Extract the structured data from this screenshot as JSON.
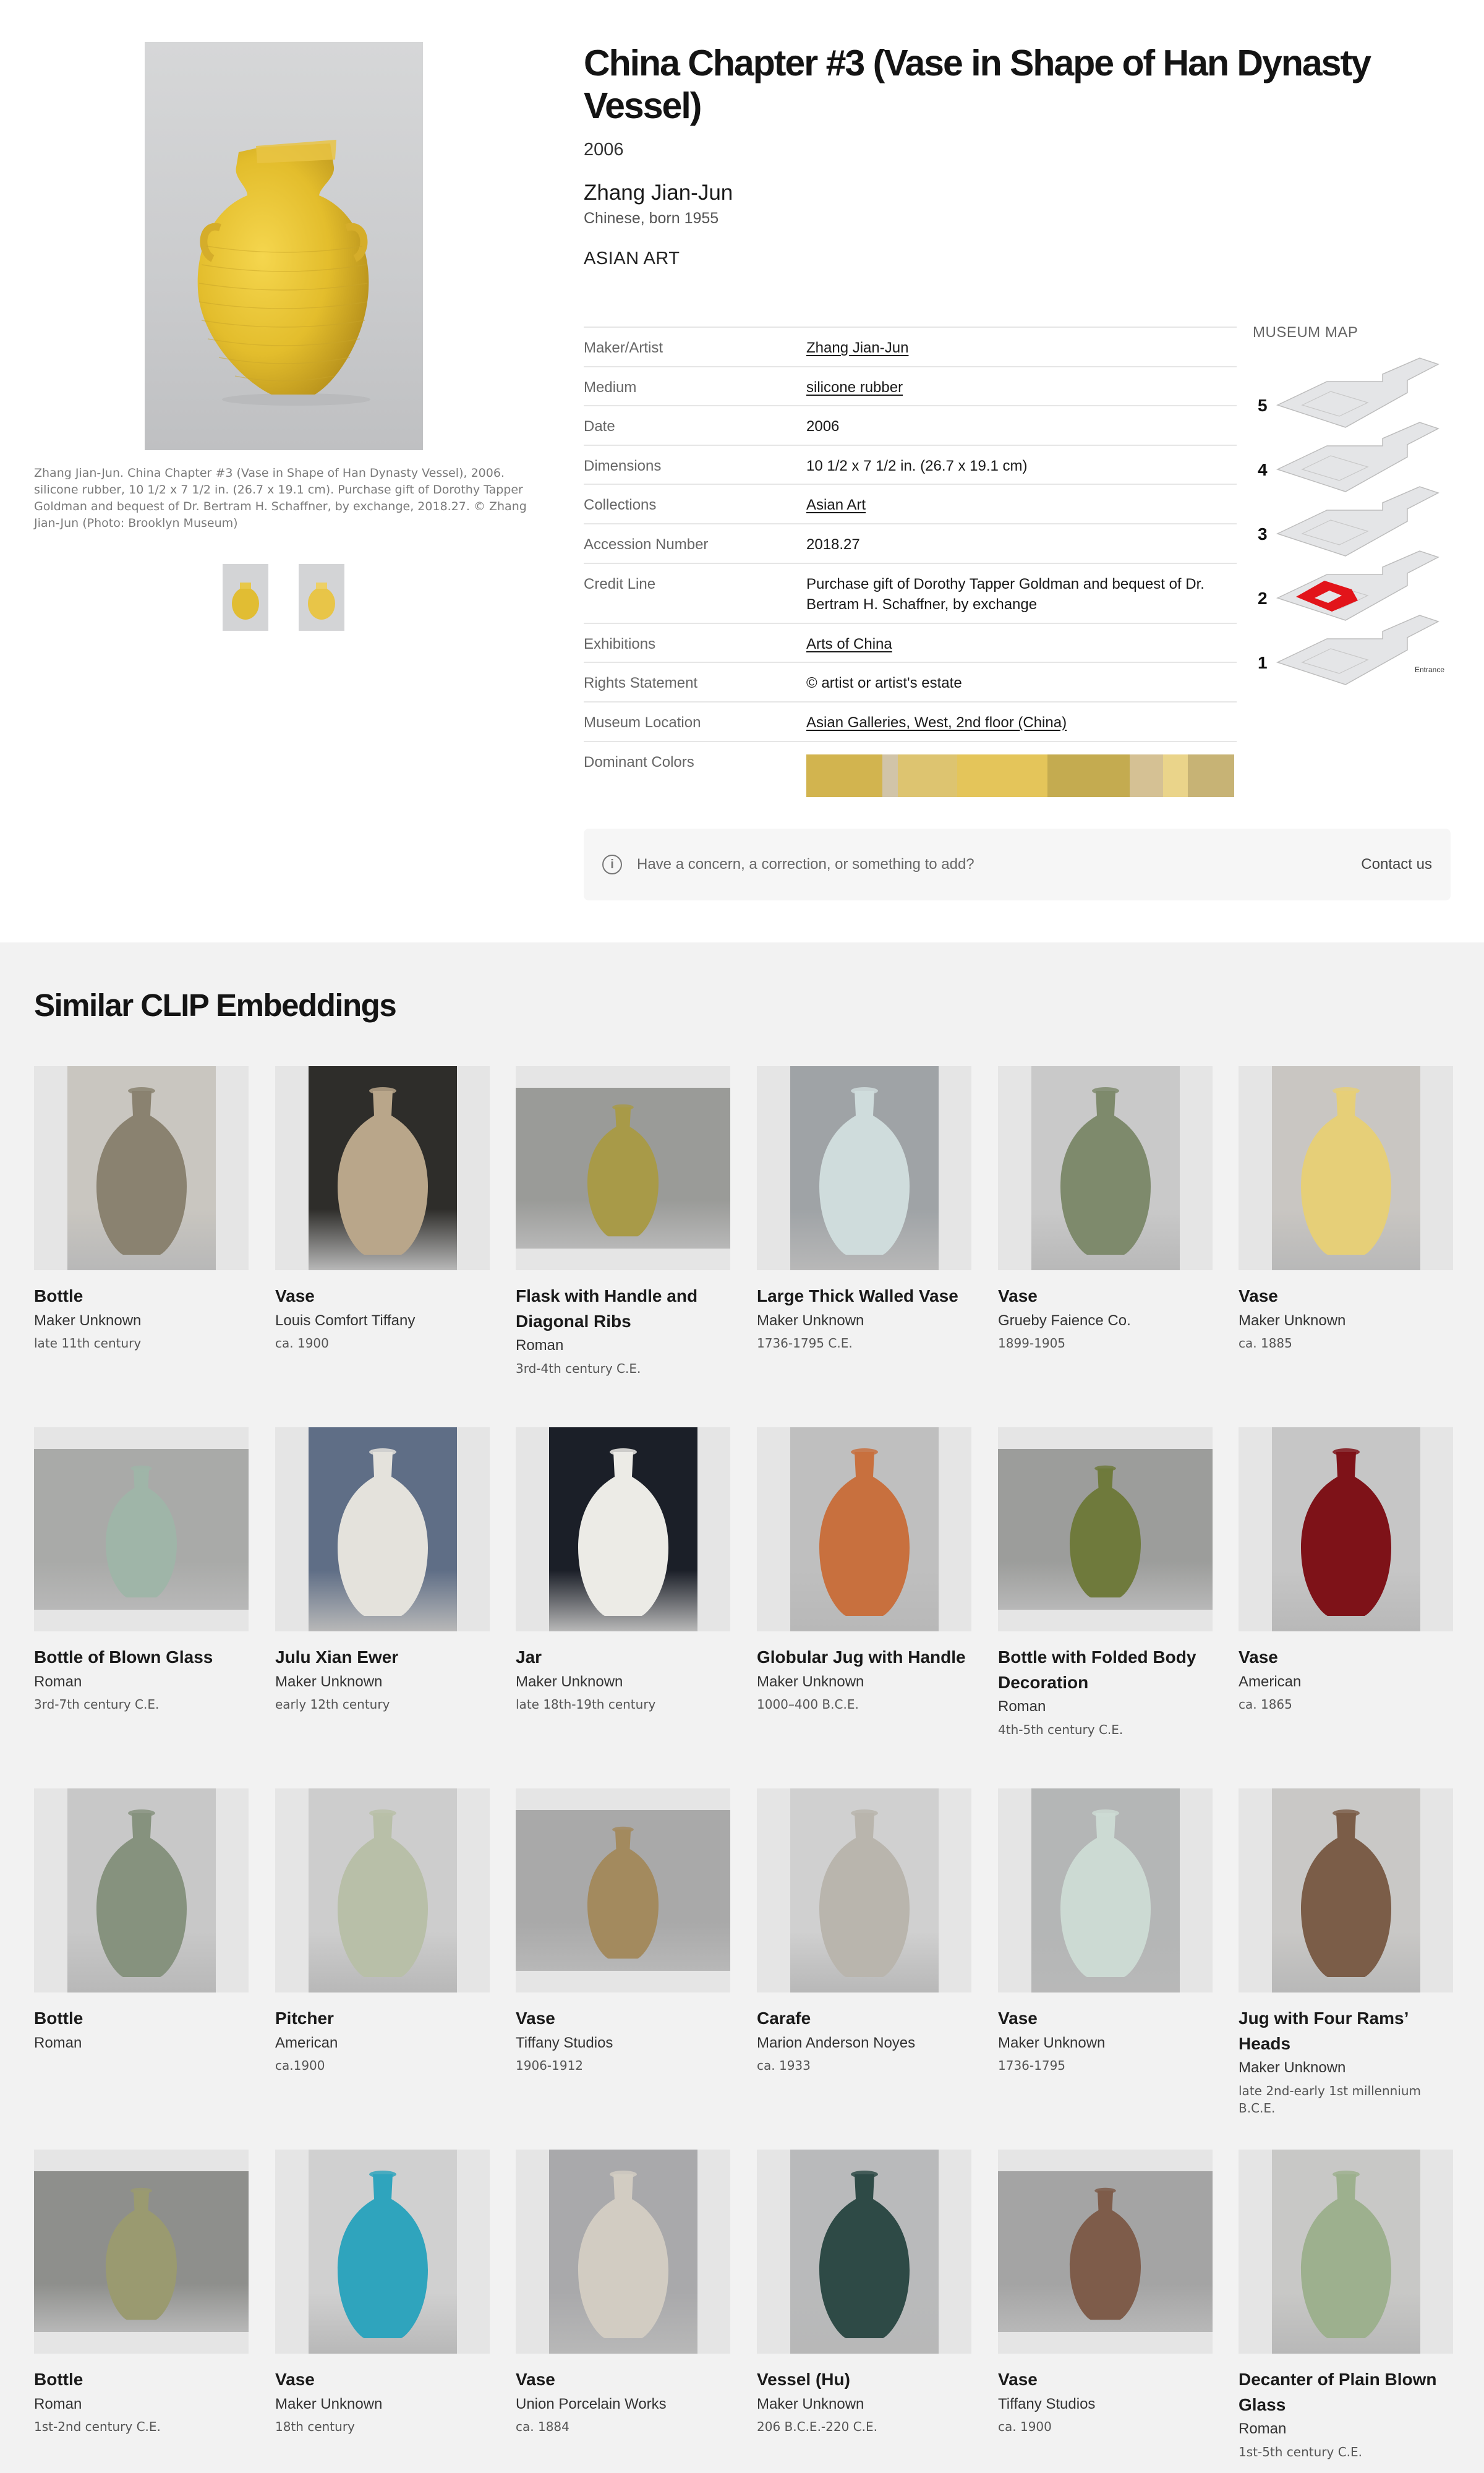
{
  "artwork": {
    "title": "China Chapter #3 (Vase in Shape of Han Dynasty Vessel)",
    "year": "2006",
    "artist": "Zhang Jian-Jun",
    "nationality": "Chinese, born 1955",
    "department": "ASIAN ART",
    "caption": "Zhang Jian-Jun. China Chapter #3 (Vase in Shape of Han Dynasty Vessel), 2006. silicone rubber, 10 1/2 x 7 1/2 in. (26.7 x 19.1 cm). Purchase gift of Dorothy Tapper Goldman and bequest of Dr. Bertram H. Schaffner, by exchange, 2018.27. © Zhang Jian-Jun (Photo: Brooklyn Museum)"
  },
  "details": {
    "maker": {
      "label": "Maker/Artist",
      "value": "Zhang Jian-Jun"
    },
    "medium": {
      "label": "Medium",
      "value": "silicone rubber"
    },
    "date": {
      "label": "Date",
      "value": "2006"
    },
    "dimensions": {
      "label": "Dimensions",
      "value": "10 1/2 x 7 1/2 in. (26.7 x 19.1 cm)"
    },
    "collections": {
      "label": "Collections",
      "value": "Asian Art"
    },
    "accession": {
      "label": "Accession Number",
      "value": "2018.27"
    },
    "credit": {
      "label": "Credit Line",
      "value": "Purchase gift of Dorothy Tapper Goldman and bequest of Dr. Bertram H. Schaffner, by exchange"
    },
    "exhibitions": {
      "label": "Exhibitions",
      "value": "Arts of China"
    },
    "rights": {
      "label": "Rights Statement",
      "value": "© artist or artist's estate"
    },
    "location": {
      "label": "Museum Location",
      "value": "Asian Galleries, West, 2nd floor (China)"
    },
    "colors_label": "Dominant Colors",
    "dominant_colors": [
      "#d2b44f",
      "#d1c4a8",
      "#ddc470",
      "#e4c55a",
      "#c4ab50",
      "#d5c194",
      "#ead48a",
      "#c7b375"
    ]
  },
  "museum_map": {
    "label": "MUSEUM MAP",
    "floors": [
      "5",
      "4",
      "3",
      "2",
      "1"
    ],
    "entrance": "Entrance",
    "highlight_floor": "2",
    "highlight_color": "#e2141a"
  },
  "concern": {
    "text": "Have a concern, a correction, or something to add?",
    "contact_label": "Contact us"
  },
  "similar": {
    "title": "Similar CLIP Embeddings",
    "items": [
      {
        "name": "Bottle",
        "maker": "Maker Unknown",
        "date": "late 11th century",
        "color": "#8a8270",
        "bg": "#c9c6c0"
      },
      {
        "name": "Vase",
        "maker": "Louis Comfort Tiffany",
        "date": "ca. 1900",
        "color": "#b9a68a",
        "bg": "#2e2d2a"
      },
      {
        "name": "Flask with Handle and Diagonal Ribs",
        "maker": "Roman",
        "date": "3rd-4th century C.E.",
        "color": "#a89a48",
        "bg": "#9a9b98"
      },
      {
        "name": "Large Thick Walled Vase",
        "maker": "Maker Unknown",
        "date": "1736-1795 C.E.",
        "color": "#cfdcdc",
        "bg": "#9fa3a6"
      },
      {
        "name": "Vase",
        "maker": "Grueby Faience Co.",
        "date": "1899-1905",
        "color": "#7e8a6c",
        "bg": "#c9c9c9"
      },
      {
        "name": "Vase",
        "maker": "Maker Unknown",
        "date": "ca. 1885",
        "color": "#e6cf78",
        "bg": "#c9c6c2"
      },
      {
        "name": "Bottle of Blown Glass",
        "maker": "Roman",
        "date": "3rd-7th century C.E.",
        "color": "#9fb5a8",
        "bg": "#a9aaa8"
      },
      {
        "name": "Julu Xian Ewer",
        "maker": "Maker Unknown",
        "date": "early 12th century",
        "color": "#e4e2dc",
        "bg": "#5f6e86"
      },
      {
        "name": "Jar",
        "maker": "Maker Unknown",
        "date": "late 18th-19th century",
        "color": "#ecebe6",
        "bg": "#1b1f28"
      },
      {
        "name": "Globular Jug with Handle",
        "maker": "Maker Unknown",
        "date": "1000–400 B.C.E.",
        "color": "#c8703e",
        "bg": "#bfbfbf"
      },
      {
        "name": "Bottle with Folded Body Decoration",
        "maker": "Roman",
        "date": "4th-5th century C.E.",
        "color": "#6f7a3c",
        "bg": "#9c9d9b"
      },
      {
        "name": "Vase",
        "maker": "American",
        "date": "ca. 1865",
        "color": "#7e1218",
        "bg": "#c6c6c6"
      },
      {
        "name": "Bottle",
        "maker": "Roman",
        "date": "",
        "color": "#86927e",
        "bg": "#c8c8c8"
      },
      {
        "name": "Pitcher",
        "maker": "American",
        "date": "ca.1900",
        "color": "#b8bfa8",
        "bg": "#cdcdcd"
      },
      {
        "name": "Vase",
        "maker": "Tiffany Studios",
        "date": "1906-1912",
        "color": "#a38a5e",
        "bg": "#a9a9a9"
      },
      {
        "name": "Carafe",
        "maker": "Marion Anderson Noyes",
        "date": "ca. 1933",
        "color": "#b9b5ad",
        "bg": "#d0d0d0"
      },
      {
        "name": "Vase",
        "maker": "Maker Unknown",
        "date": "1736-1795",
        "color": "#ccdad3",
        "bg": "#b4b6b6"
      },
      {
        "name": "Jug with Four Rams’ Heads",
        "maker": "Maker Unknown",
        "date": "late 2nd-early 1st millennium B.C.E.",
        "color": "#7b5d48",
        "bg": "#c9c8c6"
      },
      {
        "name": "Bottle",
        "maker": "Roman",
        "date": "1st-2nd century C.E.",
        "color": "#9a9a70",
        "bg": "#8e8f8c"
      },
      {
        "name": "Vase",
        "maker": "Maker Unknown",
        "date": "18th century",
        "color": "#2fa4bd",
        "bg": "#d0d0d0"
      },
      {
        "name": "Vase",
        "maker": "Union Porcelain Works",
        "date": "ca. 1884",
        "color": "#d2ccc2",
        "bg": "#a9a9ab"
      },
      {
        "name": "Vessel (Hu)",
        "maker": "Maker Unknown",
        "date": "206 B.C.E.-220 C.E.",
        "color": "#2e4a46",
        "bg": "#b9babb"
      },
      {
        "name": "Vase",
        "maker": "Tiffany Studios",
        "date": "ca. 1900",
        "color": "#7e5c4a",
        "bg": "#a4a4a4"
      },
      {
        "name": "Decanter of Plain Blown Glass",
        "maker": "Roman",
        "date": "1st-5th century C.E.",
        "color": "#9db08e",
        "bg": "#c8c8c6"
      }
    ]
  }
}
